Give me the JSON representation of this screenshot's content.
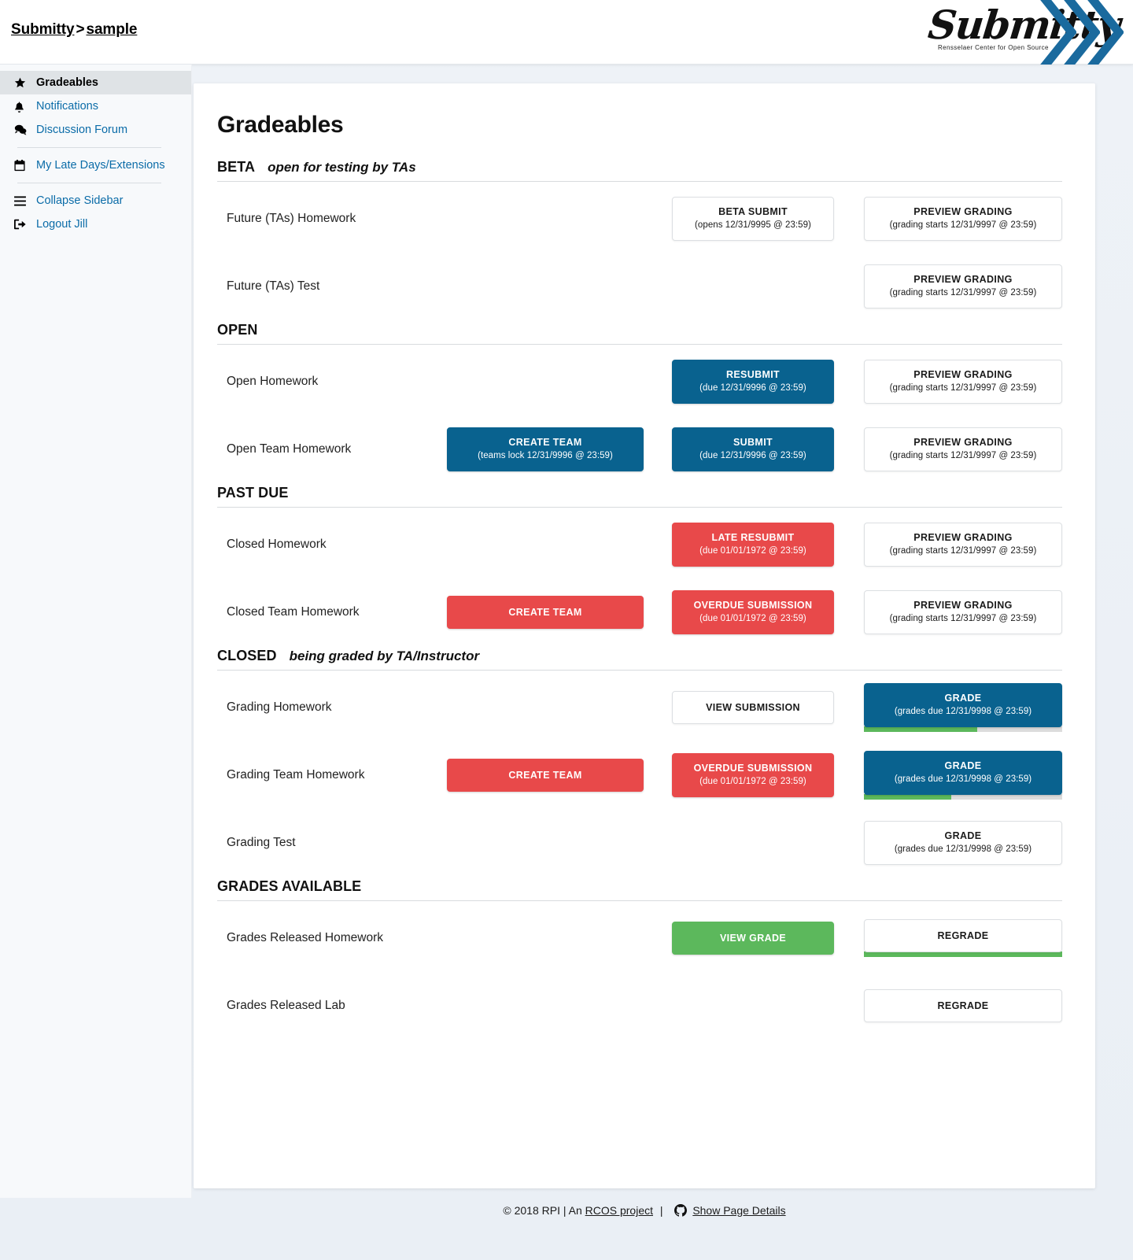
{
  "header": {
    "breadcrumb": {
      "root": "Submitty",
      "separator": ">",
      "current": "sample"
    },
    "logo": {
      "wordmark": "Submitty",
      "tagline": "Rensselaer Center for Open Source"
    }
  },
  "sidebar": {
    "items": [
      {
        "label": "Gradeables",
        "icon": "star-icon",
        "active": true
      },
      {
        "label": "Notifications",
        "icon": "bell-icon",
        "active": false
      },
      {
        "label": "Discussion Forum",
        "icon": "comments-icon",
        "active": false
      },
      {
        "label": "My Late Days/Extensions",
        "icon": "calendar-icon",
        "active": false
      },
      {
        "label": "Collapse Sidebar",
        "icon": "hamburger-icon",
        "active": false
      },
      {
        "label": "Logout Jill",
        "icon": "sign-out-icon",
        "active": false
      }
    ]
  },
  "main": {
    "page_title": "Gradeables",
    "sections": [
      {
        "title": "BETA",
        "note": "open for testing by TAs",
        "rows": [
          {
            "name": "Future (TAs) Homework",
            "team": null,
            "mid": {
              "style": "white",
              "line1": "BETA SUBMIT",
              "line2": "(opens 12/31/9995 @ 23:59)"
            },
            "grade": {
              "style": "white",
              "line1": "PREVIEW GRADING",
              "line2": "(grading starts 12/31/9997 @ 23:59)"
            }
          },
          {
            "name": "Future (TAs) Test",
            "team": null,
            "mid": null,
            "grade": {
              "style": "white",
              "line1": "PREVIEW GRADING",
              "line2": "(grading starts 12/31/9997 @ 23:59)"
            }
          }
        ]
      },
      {
        "title": "OPEN",
        "note": "",
        "rows": [
          {
            "name": "Open Homework",
            "team": null,
            "mid": {
              "style": "blue",
              "line1": "RESUBMIT",
              "line2": "(due 12/31/9996 @ 23:59)"
            },
            "grade": {
              "style": "white",
              "line1": "PREVIEW GRADING",
              "line2": "(grading starts 12/31/9997 @ 23:59)"
            }
          },
          {
            "name": "Open Team Homework",
            "team": {
              "style": "blue",
              "line1": "CREATE TEAM",
              "line2": "(teams lock 12/31/9996 @ 23:59)"
            },
            "mid": {
              "style": "blue",
              "line1": "SUBMIT",
              "line2": "(due 12/31/9996 @ 23:59)"
            },
            "grade": {
              "style": "white",
              "line1": "PREVIEW GRADING",
              "line2": "(grading starts 12/31/9997 @ 23:59)"
            }
          }
        ]
      },
      {
        "title": "PAST DUE",
        "note": "",
        "rows": [
          {
            "name": "Closed Homework",
            "team": null,
            "mid": {
              "style": "red",
              "line1": "LATE RESUBMIT",
              "line2": "(due 01/01/1972 @ 23:59)"
            },
            "grade": {
              "style": "white",
              "line1": "PREVIEW GRADING",
              "line2": "(grading starts 12/31/9997 @ 23:59)"
            }
          },
          {
            "name": "Closed Team Homework",
            "team": {
              "style": "red",
              "line1": "CREATE TEAM",
              "line2": ""
            },
            "mid": {
              "style": "red",
              "line1": "OVERDUE SUBMISSION",
              "line2": "(due 01/01/1972 @ 23:59)"
            },
            "grade": {
              "style": "white",
              "line1": "PREVIEW GRADING",
              "line2": "(grading starts 12/31/9997 @ 23:59)"
            }
          }
        ]
      },
      {
        "title": "CLOSED",
        "note": "being graded by TA/Instructor",
        "rows": [
          {
            "name": "Grading Homework",
            "team": null,
            "mid": {
              "style": "white",
              "line1": "VIEW SUBMISSION",
              "line2": ""
            },
            "grade": {
              "style": "blue",
              "line1": "GRADE",
              "line2": "(grades due 12/31/9998 @ 23:59)",
              "progress": 57
            }
          },
          {
            "name": "Grading Team Homework",
            "team": {
              "style": "red",
              "line1": "CREATE TEAM",
              "line2": ""
            },
            "mid": {
              "style": "red",
              "line1": "OVERDUE SUBMISSION",
              "line2": "(due 01/01/1972 @ 23:59)"
            },
            "grade": {
              "style": "blue",
              "line1": "GRADE",
              "line2": "(grades due 12/31/9998 @ 23:59)",
              "progress": 44
            }
          },
          {
            "name": "Grading Test",
            "team": null,
            "mid": null,
            "grade": {
              "style": "white",
              "line1": "GRADE",
              "line2": "(grades due 12/31/9998 @ 23:59)"
            }
          }
        ]
      },
      {
        "title": "GRADES AVAILABLE",
        "note": "",
        "rows": [
          {
            "name": "Grades Released Homework",
            "team": null,
            "mid": {
              "style": "green",
              "line1": "VIEW GRADE",
              "line2": ""
            },
            "grade": {
              "style": "white",
              "line1": "REGRADE",
              "line2": "",
              "progress": 100
            }
          },
          {
            "name": "Grades Released Lab",
            "team": null,
            "mid": null,
            "grade": {
              "style": "white",
              "line1": "REGRADE",
              "line2": ""
            }
          }
        ]
      }
    ]
  },
  "footer": {
    "copyright": "© 2018 RPI | An",
    "project_link": "RCOS project",
    "separator": "|",
    "page_details": "Show Page Details"
  },
  "colors": {
    "blue": "#09628f",
    "red": "#e8494a",
    "green": "#5cb85c",
    "link": "#0b6ca8",
    "progress_track": "#dcdcdc"
  }
}
